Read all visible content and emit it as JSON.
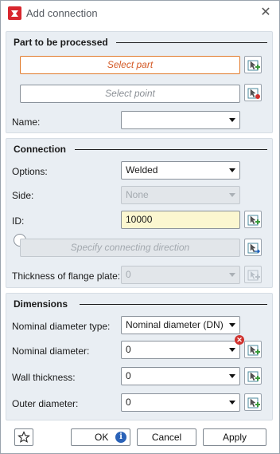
{
  "window": {
    "title": "Add connection"
  },
  "part_section": {
    "title": "Part to be processed",
    "select_part_placeholder": "Select part",
    "select_point_placeholder": "Select point",
    "name_label": "Name:",
    "name_value": ""
  },
  "connection_section": {
    "title": "Connection",
    "options_label": "Options:",
    "options_value": "Welded",
    "side_label": "Side:",
    "side_value": "None",
    "id_label": "ID:",
    "id_value": "10000",
    "direction_placeholder": "Specify connecting direction",
    "flange_label": "Thickness of flange plate:",
    "flange_value": "0"
  },
  "dimensions_section": {
    "title": "Dimensions",
    "nominal_type_label": "Nominal diameter type:",
    "nominal_type_value": "Nominal diameter (DN)",
    "nominal_diameter_label": "Nominal diameter:",
    "nominal_diameter_value": "0",
    "wall_thickness_label": "Wall thickness:",
    "wall_thickness_value": "0",
    "outer_diameter_label": "Outer diameter:",
    "outer_diameter_value": "0"
  },
  "footer": {
    "ok_label": "OK",
    "cancel_label": "Cancel",
    "apply_label": "Apply"
  },
  "colors": {
    "accent_orange": "#e07a2c",
    "yellow_field": "#fbf7d0",
    "panel_bg": "#e9eef3",
    "error_red": "#d0322e",
    "info_blue": "#2a62b8"
  }
}
